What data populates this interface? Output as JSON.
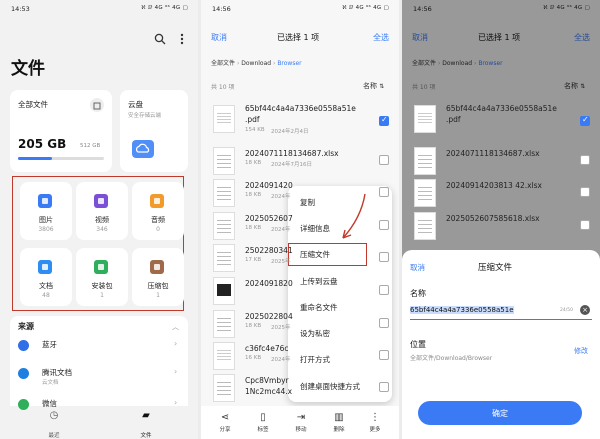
{
  "panel1": {
    "time": "14:53",
    "status_icons": "ℵ ⅅ 4G ⁶⁶ 4G ▢",
    "title": "文件",
    "storage": {
      "label": "全部文件",
      "used": "205 GB",
      "total": "512 GB",
      "fill_fraction": 0.4
    },
    "cloud": {
      "label": "云盘",
      "sub": "安全存储云端"
    },
    "categories": [
      {
        "label": "图片",
        "count": "3806",
        "color": "#3a7bf5"
      },
      {
        "label": "视频",
        "count": "346",
        "color": "#7b4fd6"
      },
      {
        "label": "音频",
        "count": "0",
        "color": "#f29b2a"
      },
      {
        "label": "文档",
        "count": "48",
        "color": "#2e8df2"
      },
      {
        "label": "安装包",
        "count": "1",
        "color": "#2fae5b"
      },
      {
        "label": "压缩包",
        "count": "1",
        "color": "#a06a4a"
      }
    ],
    "sources_title": "来源",
    "sources": [
      {
        "label": "蓝牙",
        "sub": ""
      },
      {
        "label": "腾讯文档",
        "sub": "云文档"
      },
      {
        "label": "微信",
        "sub": ""
      }
    ],
    "nav": [
      {
        "label": "最近"
      },
      {
        "label": "文件"
      }
    ]
  },
  "panel2": {
    "time": "14:56",
    "status_icons": "ℵ ⅅ 4G ⁶⁶ 4G ▢",
    "cancel": "取消",
    "title": "已选择 1 项",
    "select_all": "全选",
    "breadcrumb": [
      "全部文件",
      "Download",
      "Browser"
    ],
    "count": "共 10 项",
    "sort": "名称",
    "files": [
      {
        "name": "65bf44c4a4a7336e0558a51e",
        "name2": ".pdf",
        "size": "154 KB",
        "date": "2024年2月4日",
        "checked": true
      },
      {
        "name": "2024071118134687.xlsx",
        "size": "18 KB",
        "date": "2024年7月16日",
        "checked": false
      },
      {
        "name": "2024091420",
        "size": "18 KB",
        "date": "2024年",
        "checked": false
      },
      {
        "name": "2025052607",
        "size": "18 KB",
        "date": "2024年",
        "checked": false
      },
      {
        "name": "2502280341",
        "size": "17 KB",
        "date": "2025年",
        "checked": false
      },
      {
        "name": "2024091820",
        "size": "",
        "date": "",
        "checked": false
      },
      {
        "name": "2025022804",
        "size": "18 KB",
        "date": "2025年",
        "checked": false
      },
      {
        "name": "c36fc4e76c",
        "size": "16 KB",
        "date": "2024年",
        "checked": false
      },
      {
        "name": "Cpc8Vmbyr",
        "name2": "1Nc2mc44.x",
        "size": "",
        "date": "",
        "checked": false
      }
    ],
    "menu": [
      "复制",
      "详细信息",
      "压缩文件",
      "上传到云盘",
      "重命名文件",
      "设为私密",
      "打开方式",
      "创建桌面快捷方式"
    ],
    "toolbar": [
      "分享",
      "移动",
      "删除",
      "更多"
    ],
    "toolbar_mark": "标签"
  },
  "panel3": {
    "time": "14:56",
    "status_icons": "ℵ ⅅ 4G ⁶⁶ 4G ▢",
    "cancel": "取消",
    "title": "已选择 1 项",
    "select_all": "全选",
    "breadcrumb": [
      "全部文件",
      "Download",
      "Browser"
    ],
    "count": "共 10 项",
    "sort": "名称",
    "files": [
      {
        "name": "65bf44c4a4a7336e0558a51e",
        "name2": ".pdf",
        "size": "154 KB",
        "date": "2024年2月4日",
        "checked": true
      },
      {
        "name": "2024071118134687.xlsx",
        "size": "18 KB",
        "date": "2024年7月16日",
        "checked": false
      },
      {
        "name": "20240914203813 42.xlsx",
        "size": "18 KB",
        "date": "2024年9月14日",
        "checked": false
      },
      {
        "name": "2025052607585618.xlsx",
        "size": "18 KB",
        "date": "2025年5月26日",
        "checked": false
      }
    ],
    "dialog": {
      "cancel": "取消",
      "title": "压缩文件",
      "name_label": "名称",
      "name_value": "65bf44c4a4a7336e0558a51e",
      "char_count": "24/50",
      "location_label": "位置",
      "location_value": "全部文件/Download/Browser",
      "modify": "修改",
      "confirm": "确定"
    }
  }
}
